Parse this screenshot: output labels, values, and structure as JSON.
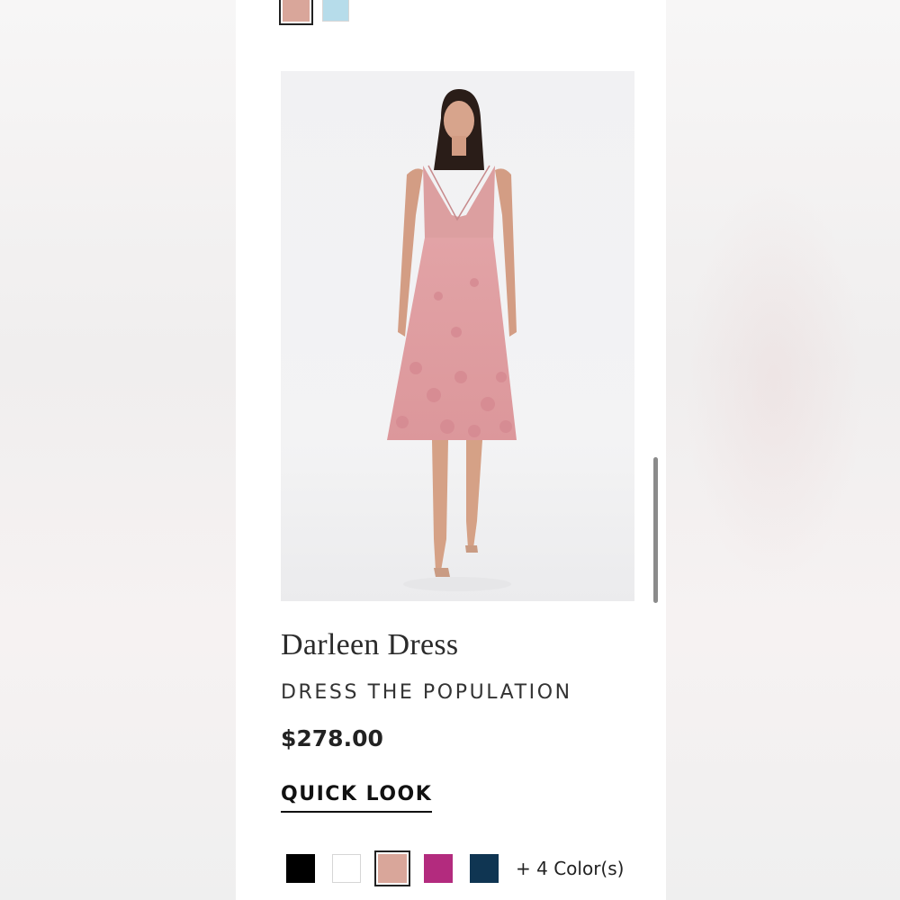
{
  "top_swatches": [
    {
      "name": "blush",
      "color": "#d9a69a",
      "selected": true
    },
    {
      "name": "light-blue",
      "color": "#b6dcea",
      "selected": false
    }
  ],
  "product": {
    "title": "Darleen Dress",
    "brand": "DRESS THE POPULATION",
    "price": "$278.00",
    "quick_look_label": "QUICK LOOK",
    "image_alt_icon": "product-photo",
    "swatches": [
      {
        "name": "black",
        "color": "#000000",
        "selected": false
      },
      {
        "name": "white",
        "color": "#ffffff",
        "selected": false
      },
      {
        "name": "blush",
        "color": "#d9a69a",
        "selected": true
      },
      {
        "name": "magenta",
        "color": "#b32b7e",
        "selected": false
      },
      {
        "name": "navy",
        "color": "#0f3552",
        "selected": false
      }
    ],
    "more_colors": "+ 4 Color(s)"
  }
}
